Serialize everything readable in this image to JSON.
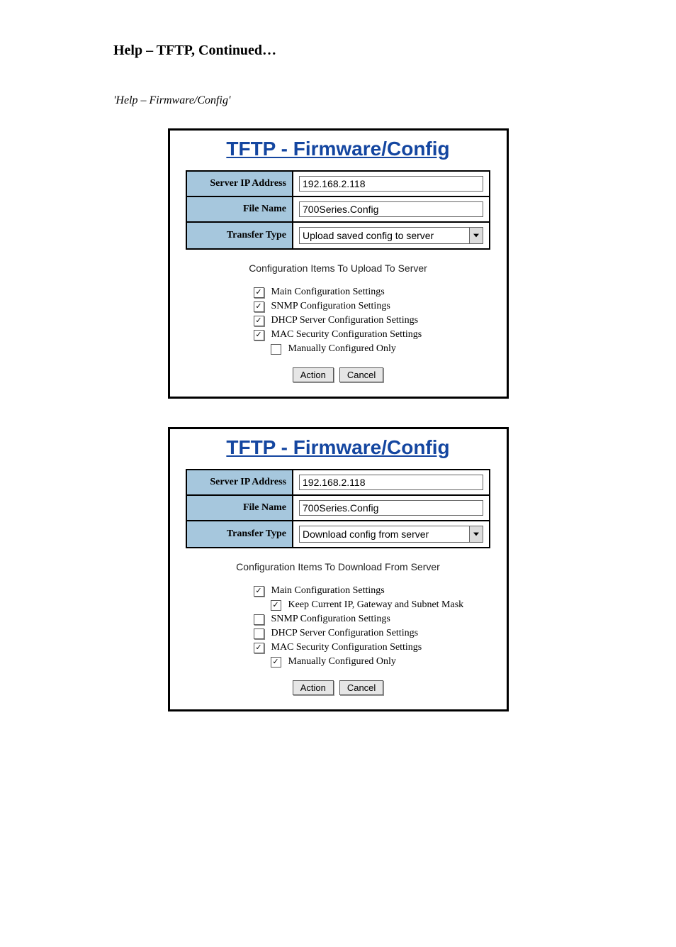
{
  "heading": "Help – TFTP, Continued…",
  "sub": "'Help – Firmware/Config'",
  "panel1": {
    "title": "TFTP - Firmware/Config",
    "rows": {
      "ip_label": "Server IP Address",
      "ip_value": "192.168.2.118",
      "file_label": "File Name",
      "file_value": "700Series.Config",
      "type_label": "Transfer Type",
      "type_value": "Upload saved config to server"
    },
    "section": "Configuration Items To Upload To Server",
    "cb": {
      "main": {
        "checked": true,
        "label": "Main Configuration Settings"
      },
      "snmp": {
        "checked": true,
        "label": "SNMP Configuration Settings"
      },
      "dhcp": {
        "checked": true,
        "label": "DHCP Server Configuration Settings"
      },
      "mac": {
        "checked": true,
        "label": "MAC Security Configuration Settings"
      },
      "manual": {
        "checked": false,
        "label": "Manually Configured Only"
      }
    },
    "buttons": {
      "action": "Action",
      "cancel": "Cancel"
    }
  },
  "panel2": {
    "title": "TFTP - Firmware/Config",
    "rows": {
      "ip_label": "Server IP Address",
      "ip_value": "192.168.2.118",
      "file_label": "File Name",
      "file_value": "700Series.Config",
      "type_label": "Transfer Type",
      "type_value": "Download config from server"
    },
    "section": "Configuration Items To Download From Server",
    "cb": {
      "main": {
        "checked": true,
        "label": "Main Configuration Settings"
      },
      "keepip": {
        "checked": true,
        "label": "Keep Current IP, Gateway and Subnet Mask"
      },
      "snmp": {
        "checked": false,
        "label": "SNMP Configuration Settings"
      },
      "dhcp": {
        "checked": false,
        "label": "DHCP Server Configuration Settings"
      },
      "mac": {
        "checked": true,
        "label": "MAC Security Configuration Settings"
      },
      "manual": {
        "checked": true,
        "label": "Manually Configured Only"
      }
    },
    "buttons": {
      "action": "Action",
      "cancel": "Cancel"
    }
  }
}
